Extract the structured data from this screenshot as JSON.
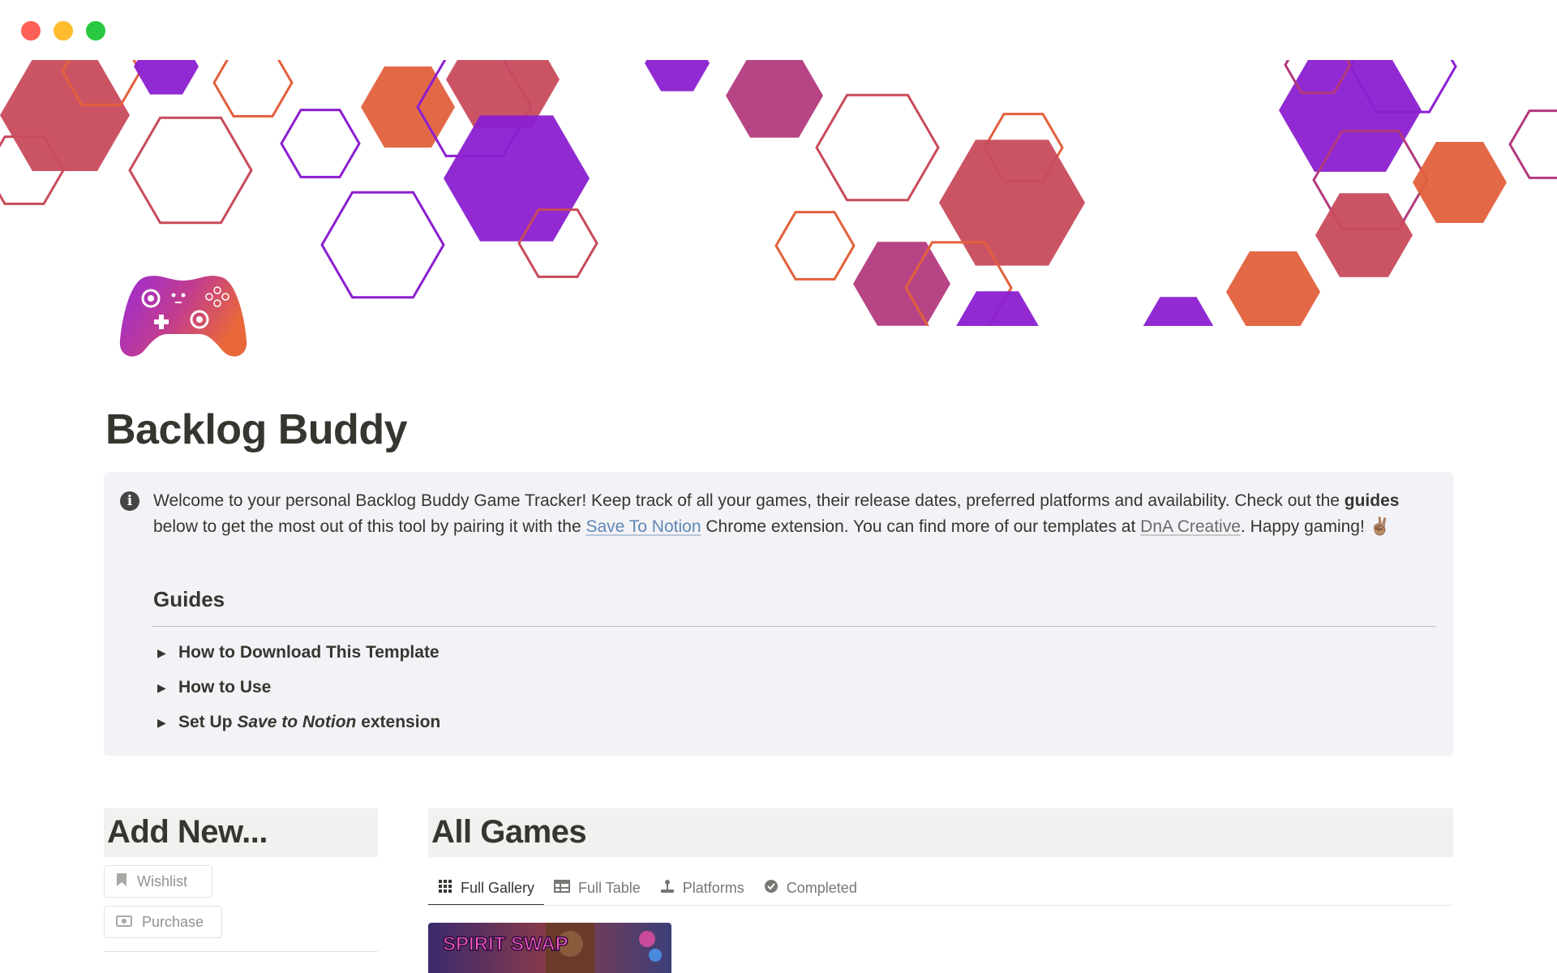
{
  "window": {
    "controls": [
      "close",
      "minimize",
      "maximize"
    ]
  },
  "cover": {
    "description_icon": "hexagon-pattern",
    "colors": [
      "#c84b5c",
      "#8b1fd0",
      "#e2603c",
      "#b33a7e"
    ]
  },
  "page": {
    "icon": "game-controller-icon",
    "title": "Backlog Buddy"
  },
  "callout": {
    "icon": "info-icon",
    "text_1": "Welcome to your personal Backlog Buddy Game Tracker! Keep track of all your games, their release dates, preferred platforms and availability. Check out the ",
    "bold_guides": "guides",
    "text_2": " below to get the most out of this tool by pairing it with the ",
    "link_save": "Save To Notion",
    "text_3": " Chrome extension. You can find more of our templates at ",
    "link_dna": "DnA Creative",
    "text_4": ". Happy gaming! ",
    "emoji": "✌🏽",
    "guides_heading": "Guides",
    "toggles": [
      {
        "label": "How to Download This Template"
      },
      {
        "label": "How to Use"
      },
      {
        "label_prefix": "Set Up ",
        "label_italic": "Save to Notion",
        "label_suffix": " extension"
      }
    ]
  },
  "add_new": {
    "heading": "Add New...",
    "buttons": [
      {
        "label": "Wishlist",
        "icon": "bookmark-icon"
      },
      {
        "label": "Purchase",
        "icon": "money-icon"
      }
    ]
  },
  "all_games": {
    "heading": "All Games",
    "tabs": [
      {
        "label": "Full Gallery",
        "icon": "gallery-icon",
        "active": true
      },
      {
        "label": "Full Table",
        "icon": "table-icon",
        "active": false
      },
      {
        "label": "Platforms",
        "icon": "joystick-icon",
        "active": false
      },
      {
        "label": "Completed",
        "icon": "check-circle-icon",
        "active": false
      }
    ],
    "first_card_cover": "SPIRIT SWAP"
  }
}
